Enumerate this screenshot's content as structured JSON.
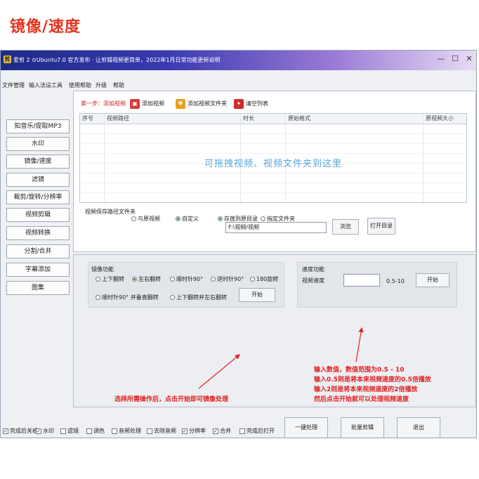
{
  "heading": "镜像/速度",
  "window": {
    "title": "爱剪 2 ⊙Ubuntu7.0 官方发布 · 让剪辑视频更简单，2022年1月日常功能更新说明",
    "app_icon": "剪",
    "minimize": "—",
    "maximize": "☐",
    "close": "✕"
  },
  "menu": [
    "文件管理",
    "输入法设工具",
    "使用帮助",
    "升级",
    "帮助"
  ],
  "sidebar": [
    "知音乐/提取MP3",
    "水印",
    "镜像/速度",
    "滤镜",
    "裁剪/旋转/分辨率",
    "视频剪辑",
    "视频转换",
    "分割/合并",
    "字幕添加",
    "图集"
  ],
  "toolbar": {
    "step": "第一步：添加视频",
    "add_video": "添加视频",
    "add_folder": "添加视频文件夹",
    "clear": "清空列表"
  },
  "table": {
    "columns": [
      "序号",
      "视频路径",
      "时长",
      "原始格式",
      "原视频大小"
    ],
    "drop_hint": "可拖拽视频、视频文件夹到这里"
  },
  "output": {
    "label": "视频保存路径文件夹",
    "options": [
      "与原视频",
      "自定义",
      "存放到原目录",
      "指定文件夹"
    ],
    "path": "F:\\视频/视频",
    "browse": "浏览",
    "open_dir": "打开目录"
  },
  "mirror": {
    "title": "镜像功能",
    "options": [
      "上下翻转",
      "左右翻转",
      "顺时针90°",
      "逆时针90°",
      "180旋转",
      "顺时针90° 并垂直翻转",
      "上下翻转并左右翻转"
    ],
    "start": "开始"
  },
  "speed": {
    "title": "速度功能",
    "label": "视频速度",
    "value": "",
    "unit": "0.5-10",
    "start": "开始"
  },
  "annotations": {
    "left": "选择所需操作后，点击开始即可镜像处理",
    "right": [
      "输入数值，数值范围为0.5 - 10",
      "输入0.5则是将本来视频速度的0.5倍播放",
      "输入2则是将本来视频速度的2倍播放",
      "然后点击开始就可以处理视频速度"
    ]
  },
  "footer": {
    "checks": [
      "完成后关机",
      "水印",
      "滤镜",
      "调色",
      "音频处理",
      "去除音频",
      "分辨率",
      "合并",
      "完成后打开"
    ],
    "buttons": [
      "一键处理",
      "批量剪辑",
      "退出"
    ]
  },
  "colors": {
    "heading": "#e8321e",
    "annotation": "#e02020",
    "hint": "#5aa8d8"
  }
}
